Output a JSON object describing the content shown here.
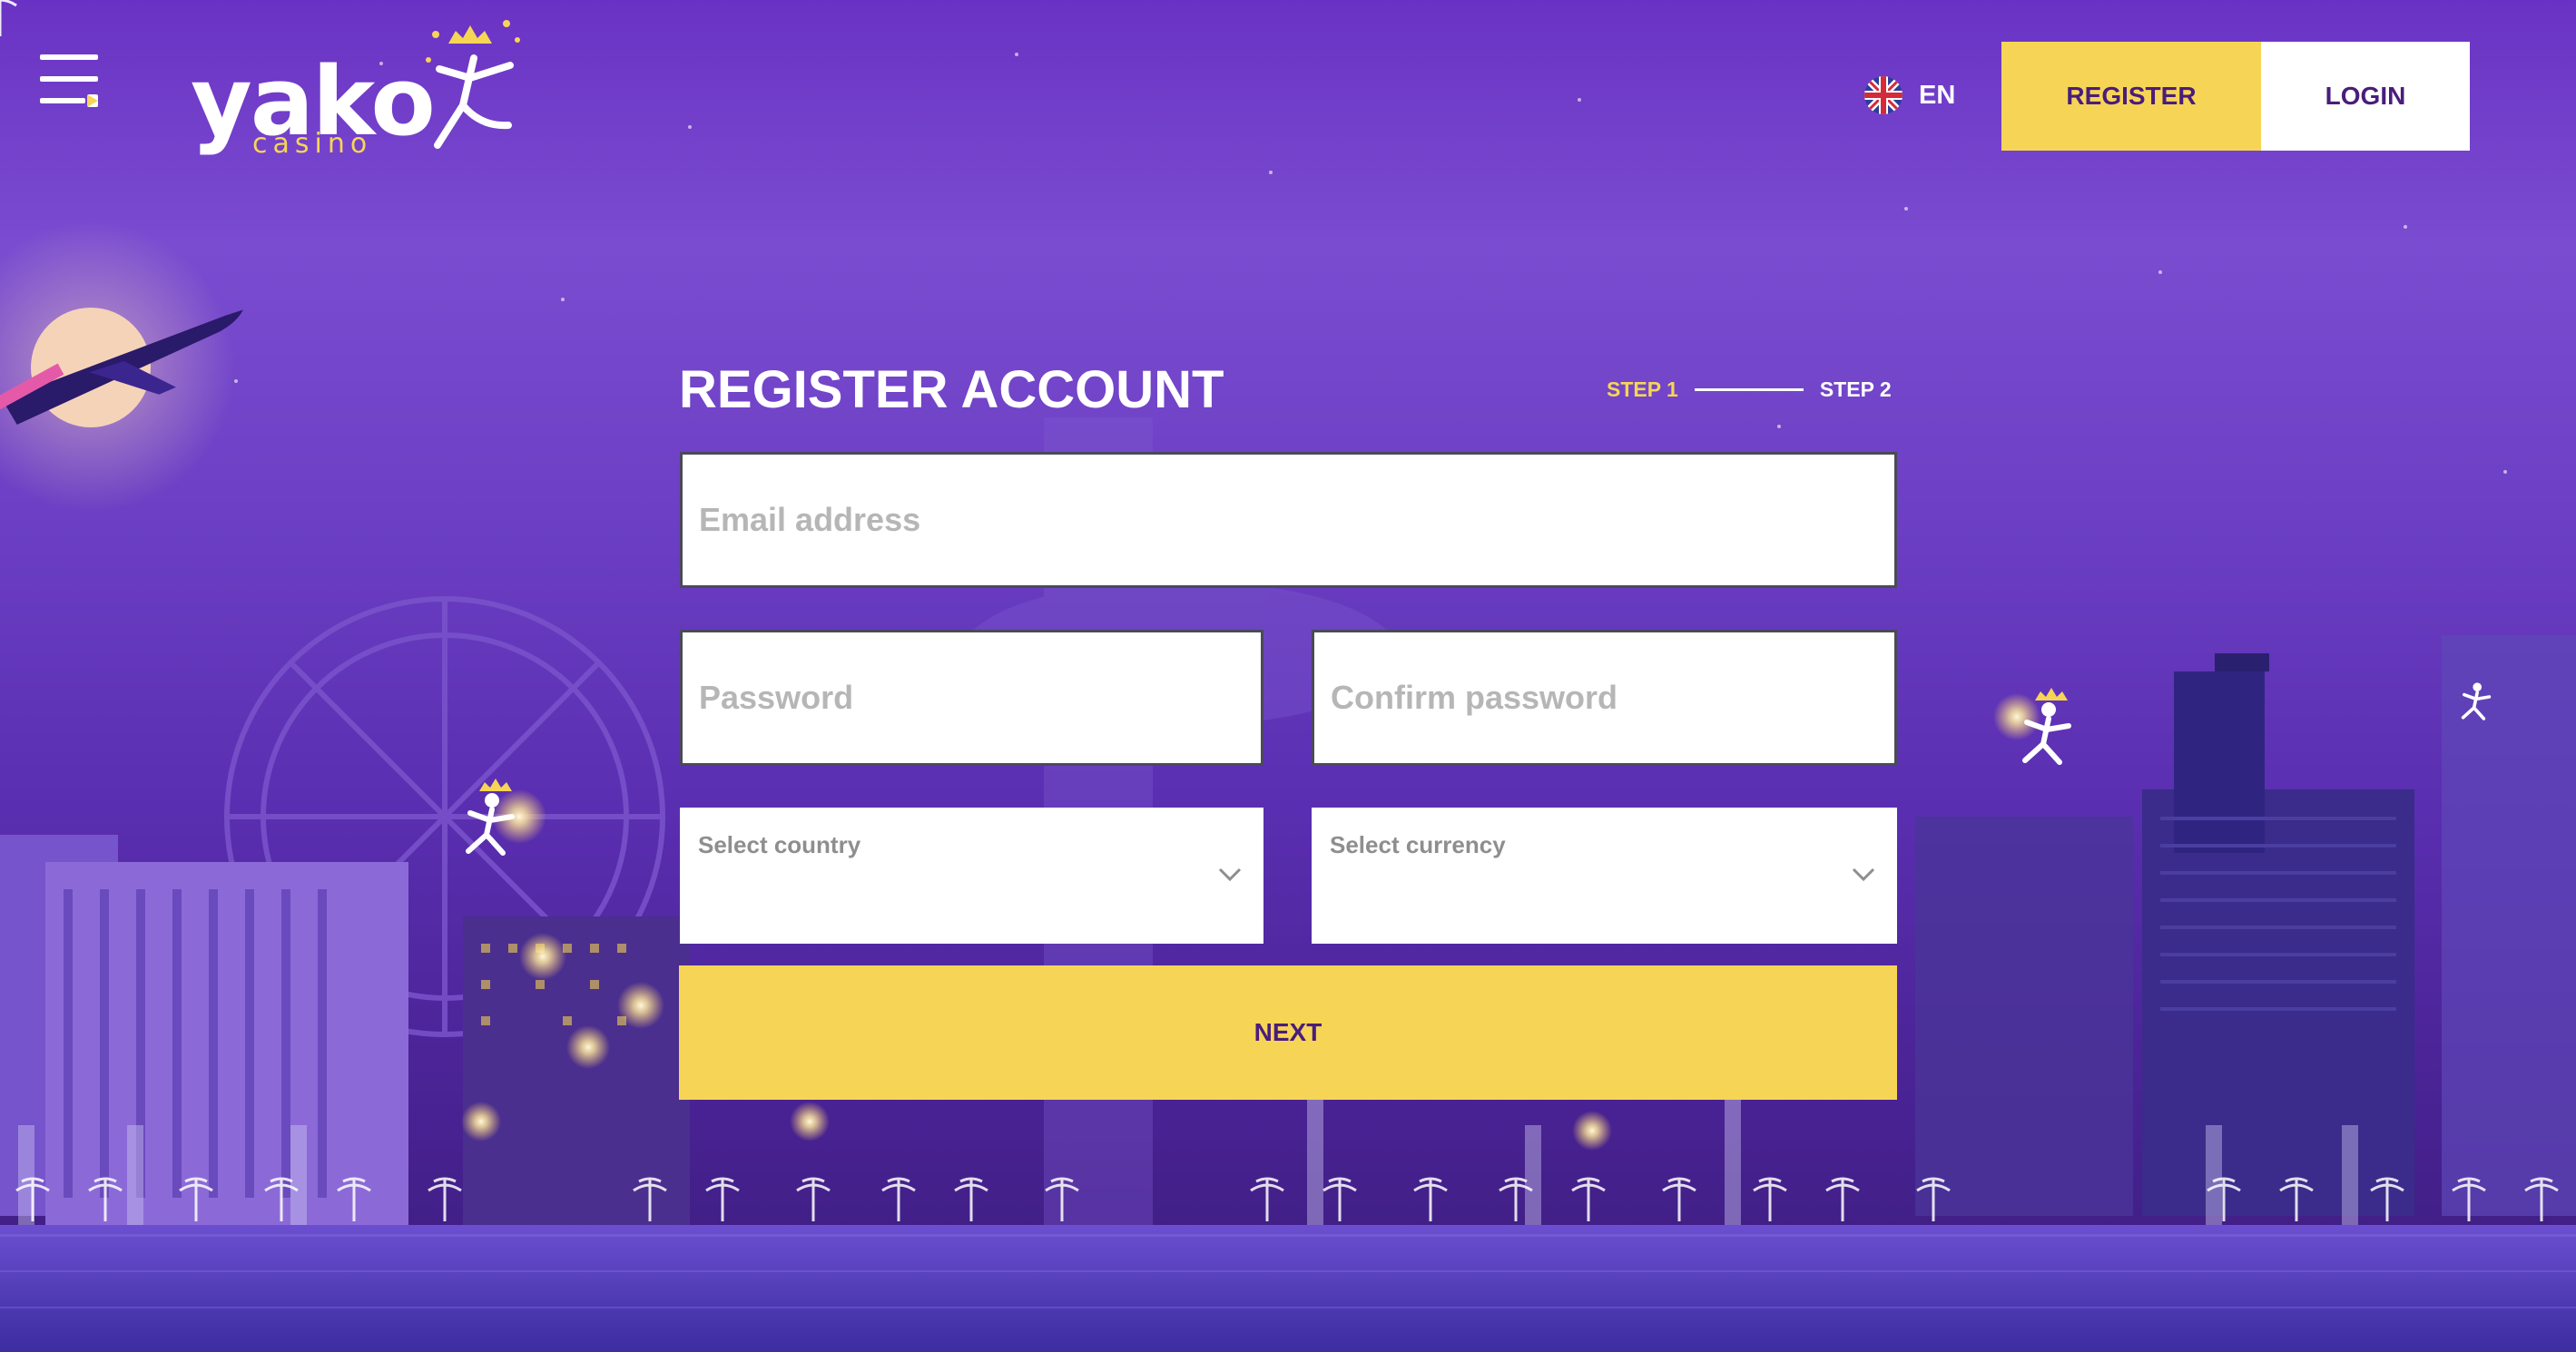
{
  "brand": {
    "logo_word": "yako",
    "logo_sub": "casino",
    "yellow": "#f6d556",
    "purple_dark": "#4a1d7a"
  },
  "header": {
    "menu_icon": "hamburger-menu-icon",
    "language": {
      "code": "EN",
      "flag_icon": "uk-flag-icon"
    },
    "register_label": "REGISTER",
    "login_label": "LOGIN"
  },
  "form": {
    "title": "REGISTER ACCOUNT",
    "steps": {
      "step1": "STEP 1",
      "step2": "STEP 2"
    },
    "email_placeholder": "Email address",
    "password_placeholder": "Password",
    "confirm_placeholder": "Confirm password",
    "country_label": "Select country",
    "currency_label": "Select currency",
    "next_label": "NEXT"
  }
}
